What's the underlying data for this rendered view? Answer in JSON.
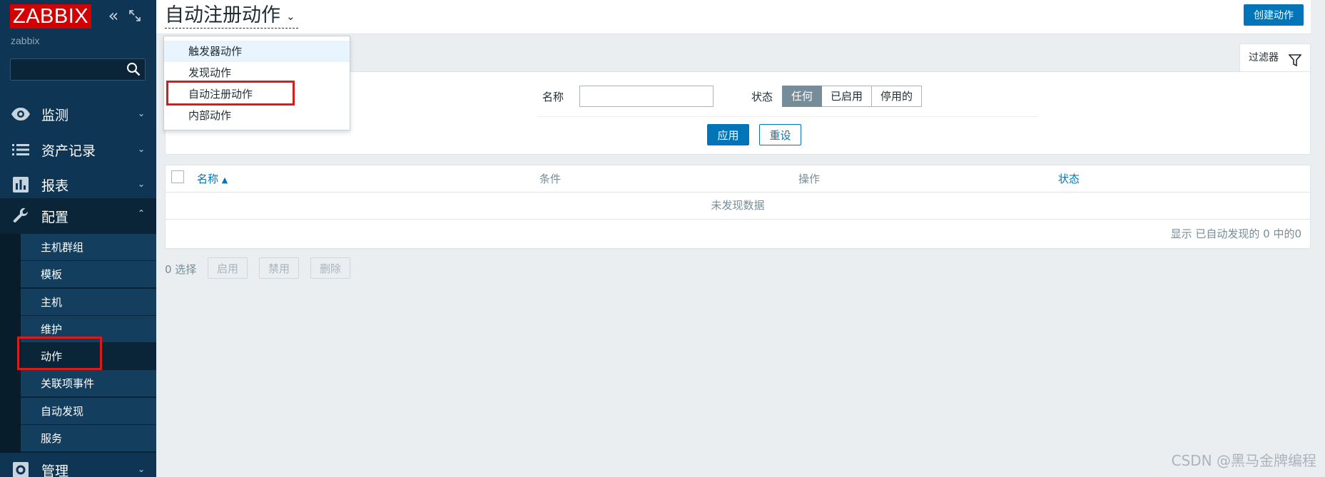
{
  "sidebar": {
    "logo": "ZABBIX",
    "server_name": "zabbix",
    "search_value": "",
    "menu": [
      {
        "label": "监测",
        "icon": "eye-icon"
      },
      {
        "label": "资产记录",
        "icon": "list-icon"
      },
      {
        "label": "报表",
        "icon": "bar-chart-icon"
      },
      {
        "label": "配置",
        "icon": "wrench-icon"
      },
      {
        "label": "管理",
        "icon": "gear-icon"
      }
    ],
    "submenu": [
      "主机群组",
      "模板",
      "主机",
      "维护",
      "动作",
      "关联项事件",
      "自动发现",
      "服务"
    ]
  },
  "header": {
    "title": "自动注册动作",
    "create_label": "创建动作"
  },
  "dropdown": {
    "items": [
      "触发器动作",
      "发现动作",
      "自动注册动作",
      "内部动作"
    ]
  },
  "filter": {
    "tab_label": "过滤器",
    "name_label": "名称",
    "name_value": "",
    "status_label": "状态",
    "status_options": [
      "任何",
      "已启用",
      "停用的"
    ],
    "apply_label": "应用",
    "reset_label": "重设"
  },
  "table": {
    "columns": [
      "名称",
      "条件",
      "操作",
      "状态"
    ],
    "sort_indicator": "▲",
    "no_data": "未发现数据",
    "pager": "显示 已自动发现的 0 中的0"
  },
  "footer": {
    "selected": "0 选择",
    "buttons": [
      "启用",
      "禁用",
      "删除"
    ]
  },
  "watermark": "CSDN @黑马金牌编程",
  "colors": {
    "sidebar_bg": "#0e3553",
    "logo_red": "#d40000",
    "accent_blue": "#0275b8",
    "highlight_red": "#d91b1b"
  }
}
